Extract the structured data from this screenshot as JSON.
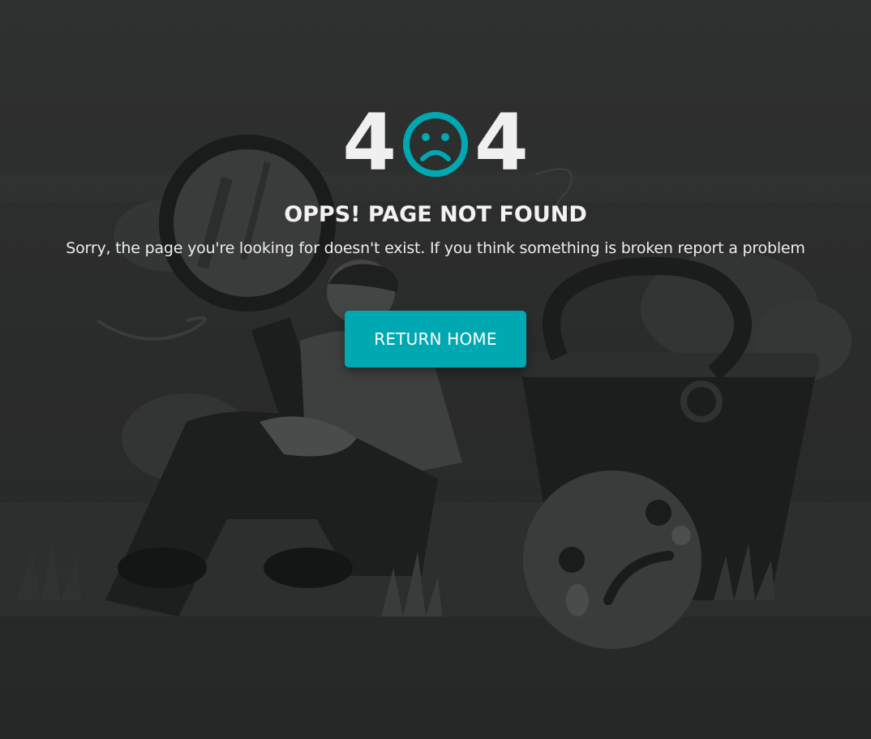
{
  "error": {
    "digit_left": "4",
    "digit_right": "4",
    "face_icon": "sad-face-icon",
    "accent_color": "#00a8b2"
  },
  "heading": "OPPS! PAGE NOT FOUND",
  "message": "Sorry, the page you're looking for doesn't exist. If you think something is broken report a problem",
  "button": {
    "label": "RETURN HOME"
  },
  "colors": {
    "background": "#2a2b2b",
    "text": "#f2f2f2"
  }
}
